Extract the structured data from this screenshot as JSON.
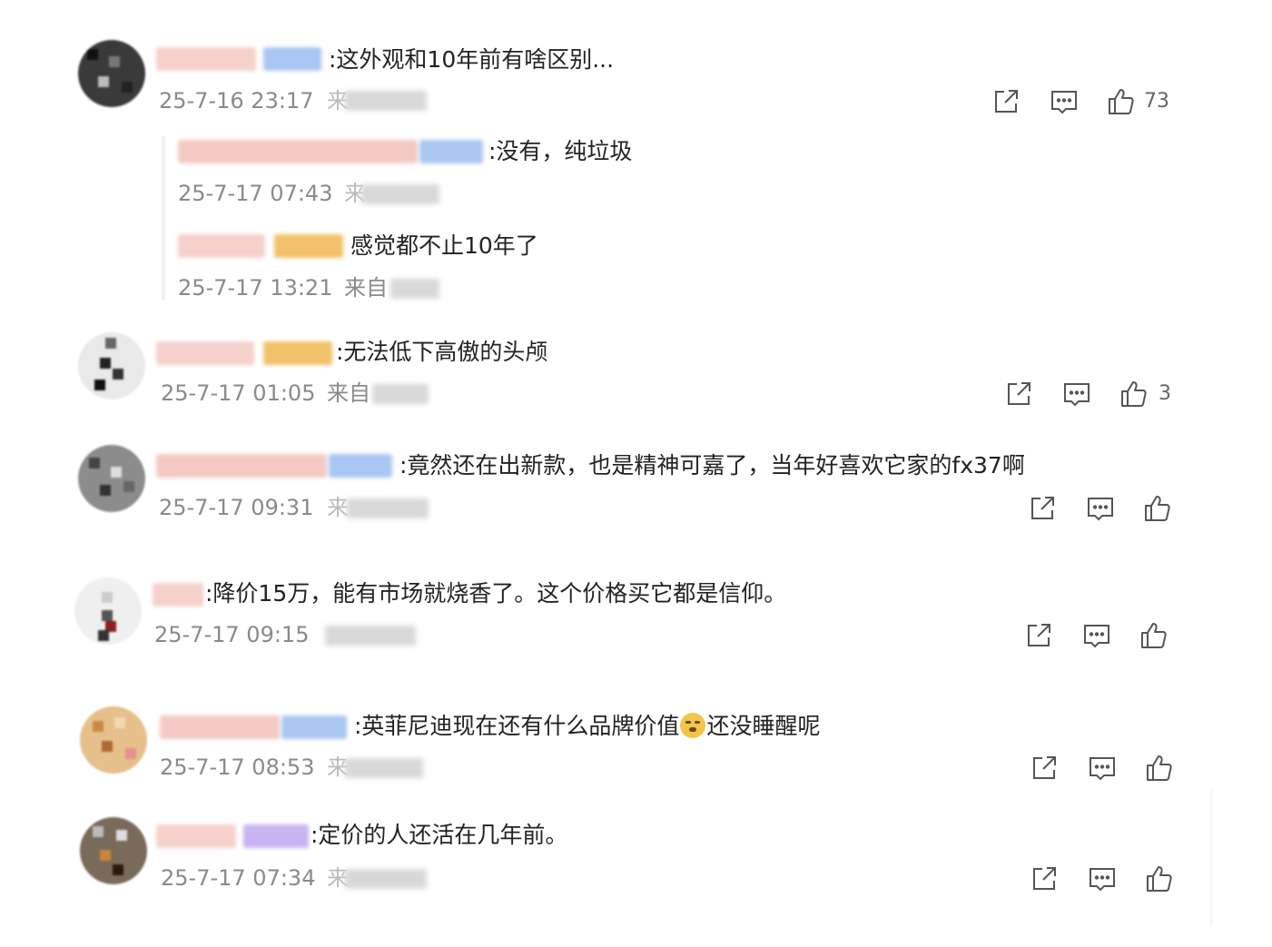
{
  "comments": [
    {
      "text": ":这外观和10年前有啥区别...",
      "time": "25-7-16 23:17",
      "source_prefix": "来",
      "likes": "73",
      "replies": [
        {
          "text": ":没有，纯垃圾",
          "time": "25-7-17 07:43",
          "source_prefix": "来"
        },
        {
          "text": "感觉都不止10年了",
          "time": "25-7-17 13:21",
          "source_prefix": "来自"
        }
      ]
    },
    {
      "text": ":无法低下高傲的头颅",
      "time": "25-7-17 01:05",
      "source_prefix": "来自",
      "likes": "3"
    },
    {
      "text": ":竟然还在出新款，也是精神可嘉了，当年好喜欢它家的fx37啊",
      "time": "25-7-17 09:31",
      "source_prefix": "来",
      "likes": ""
    },
    {
      "text": ":降价15万，能有市场就烧香了。这个价格买它都是信仰。",
      "time": "25-7-17 09:15",
      "source_prefix": "",
      "likes": ""
    },
    {
      "text_before": ":英菲尼迪现在还有什么品牌价值",
      "emoji": "doubt-face-emoji",
      "text_after": "还没睡醒呢",
      "time": "25-7-17 08:53",
      "source_prefix": "来",
      "likes": ""
    },
    {
      "text": ":定价的人还活在几年前。",
      "time": "25-7-17 07:34",
      "source_prefix": "来",
      "likes": ""
    }
  ],
  "icons": {
    "share": "share-icon",
    "comment": "comment-icon",
    "like": "thumbs-up-icon"
  },
  "colors": {
    "text": "#222222",
    "meta": "#8a8a8a",
    "icon": "#555555",
    "name_blur_pink": "#f4c9c3",
    "badge_blue": "#a9c6f2",
    "badge_yellow": "#f2c26a",
    "badge_purple": "#c9b3f0"
  }
}
